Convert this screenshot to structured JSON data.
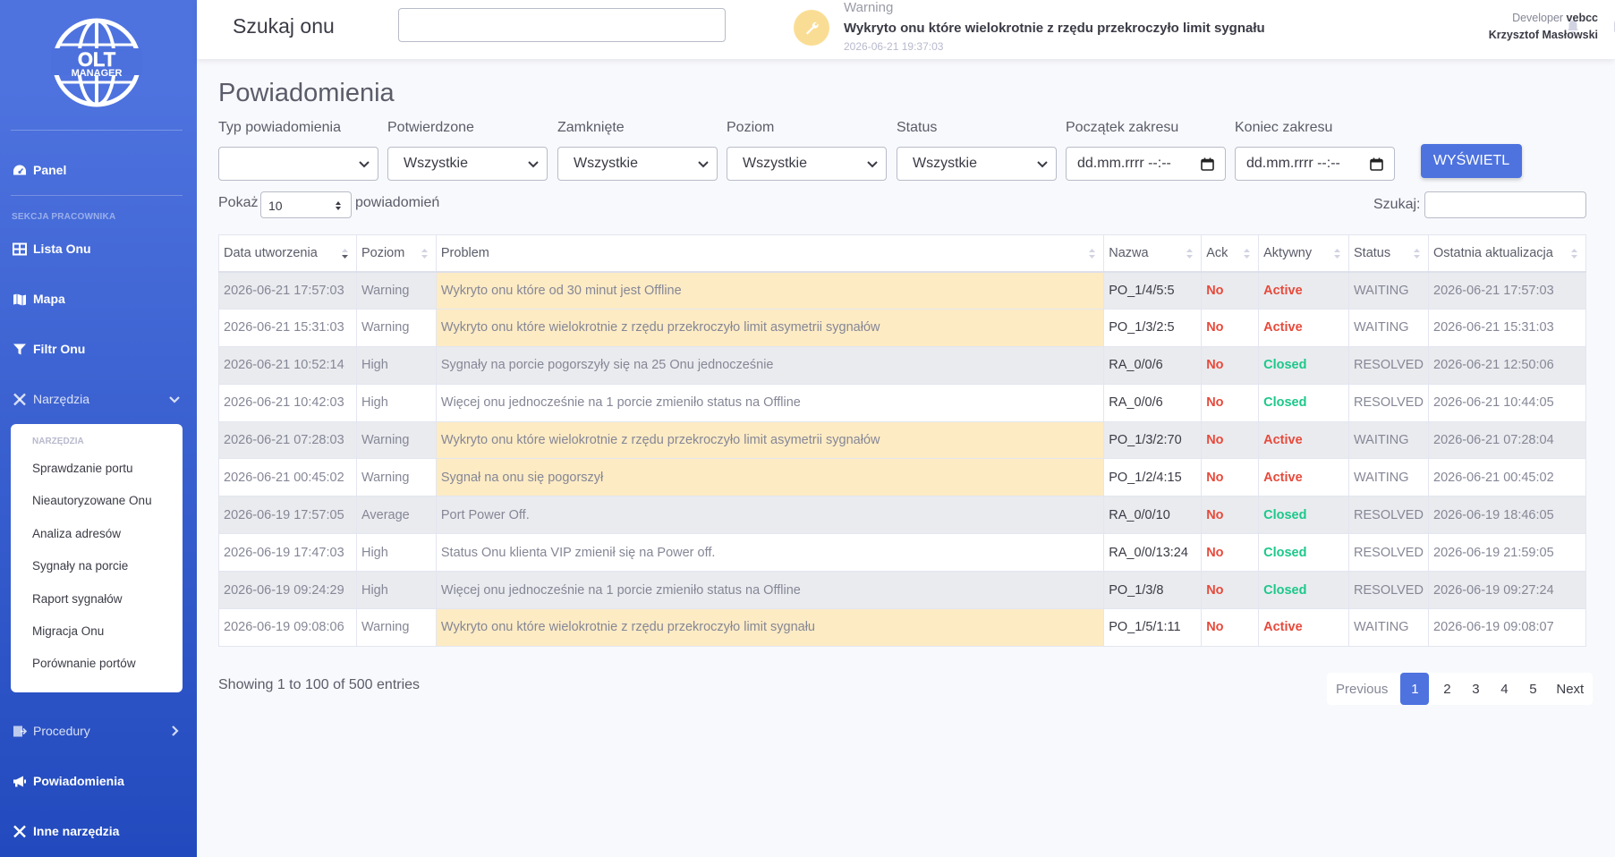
{
  "sidebar": {
    "logo_text_top": "OLT",
    "logo_text_bottom": "MANAGER",
    "panel": "Panel",
    "section_heading": "SEKCJA PRACOWNIKA",
    "items": {
      "lista_onu": "Lista Onu",
      "mapa": "Mapa",
      "filtr_onu": "Filtr Onu",
      "narzedzia": "Narzędzia",
      "procedury": "Procedury",
      "powiadomienia": "Powiadomienia",
      "inne": "Inne narzędzia"
    },
    "submenu": {
      "heading": "NARZĘDZIA",
      "items": [
        "Sprawdzanie portu",
        "Nieautoryzowane Onu",
        "Analiza adresów",
        "Sygnały na porcie",
        "Raport sygnałów",
        "Migracja Onu",
        "Porównanie portów"
      ]
    }
  },
  "topbar": {
    "search_title": "Szukaj onu",
    "alert_level": "Warning",
    "alert_message": "Wykryto onu które wielokrotnie z rzędu przekroczyło limit sygnału",
    "alert_time": "2026-06-21 19:37:03",
    "user_role": "Developer",
    "user_login": "vebcc",
    "user_name": "Krzysztof Masłowski"
  },
  "page": {
    "title": "Powiadomienia",
    "filters": {
      "type_label": "Typ powiadomienia",
      "type_value": "",
      "confirmed_label": "Potwierdzone",
      "confirmed_value": "Wszystkie",
      "closed_label": "Zamknięte",
      "closed_value": "Wszystkie",
      "level_label": "Poziom",
      "level_value": "Wszystkie",
      "status_label": "Status",
      "status_value": "Wszystkie",
      "start_label": "Początek zakresu",
      "start_placeholder": "dd.mm.rrrr --:--",
      "end_label": "Koniec zakresu",
      "end_placeholder": "dd.mm.rrrr --:--",
      "button": "WYŚWIETL"
    },
    "show_label": "Pokaż",
    "show_value": "10",
    "show_suffix": "powiadomień",
    "search_label": "Szukaj:",
    "table": {
      "headers": [
        "Data utworzenia",
        "Poziom",
        "Problem",
        "Nazwa",
        "Ack",
        "Aktywny",
        "Status",
        "Ostatnia aktualizacja"
      ],
      "rows": [
        [
          "2026-06-21 17:57:03",
          "Warning",
          "Wykryto onu które od 30 minut jest Offline",
          "PO_1/4/5:5",
          "No",
          "Active",
          "WAITING",
          "2026-06-21 17:57:03"
        ],
        [
          "2026-06-21 15:31:03",
          "Warning",
          "Wykryto onu które wielokrotnie z rzędu przekroczyło limit asymetrii sygnałów",
          "PO_1/3/2:5",
          "No",
          "Active",
          "WAITING",
          "2026-06-21 15:31:03"
        ],
        [
          "2026-06-21 10:52:14",
          "High",
          "Sygnały na porcie pogorszyły się na 25 Onu jednocześnie",
          "RA_0/0/6",
          "No",
          "Closed",
          "RESOLVED",
          "2026-06-21 12:50:06"
        ],
        [
          "2026-06-21 10:42:03",
          "High",
          "Więcej onu jednocześnie na 1 porcie zmieniło status na Offline",
          "RA_0/0/6",
          "No",
          "Closed",
          "RESOLVED",
          "2026-06-21 10:44:05"
        ],
        [
          "2026-06-21 07:28:03",
          "Warning",
          "Wykryto onu które wielokrotnie z rzędu przekroczyło limit asymetrii sygnałów",
          "PO_1/3/2:70",
          "No",
          "Active",
          "WAITING",
          "2026-06-21 07:28:04"
        ],
        [
          "2026-06-21 00:45:02",
          "Warning",
          "Sygnał na onu się pogorszył",
          "PO_1/2/4:15",
          "No",
          "Active",
          "WAITING",
          "2026-06-21 00:45:02"
        ],
        [
          "2026-06-19 17:57:05",
          "Average",
          "Port Power Off.",
          "RA_0/0/10",
          "No",
          "Closed",
          "RESOLVED",
          "2026-06-19 18:46:05"
        ],
        [
          "2026-06-19 17:47:03",
          "High",
          "Status Onu klienta VIP zmienił się na Power off.",
          "RA_0/0/13:24",
          "No",
          "Closed",
          "RESOLVED",
          "2026-06-19 21:59:05"
        ],
        [
          "2026-06-19 09:24:29",
          "High",
          "Więcej onu jednocześnie na 1 porcie zmieniło status na Offline",
          "PO_1/3/8",
          "No",
          "Closed",
          "RESOLVED",
          "2026-06-19 09:27:24"
        ],
        [
          "2026-06-19 09:08:06",
          "Warning",
          "Wykryto onu które wielokrotnie z rzędu przekroczyło limit sygnału",
          "PO_1/5/1:11",
          "No",
          "Active",
          "WAITING",
          "2026-06-19 09:08:07"
        ]
      ]
    },
    "entries_info": "Showing 1 to 100 of 500 entries",
    "pagination": {
      "previous": "Previous",
      "pages": [
        "1",
        "2",
        "3",
        "4",
        "5"
      ],
      "active_page": "1",
      "next": "Next"
    }
  },
  "colors": {
    "primary": "#4e73df",
    "warning_row": "#fdebc4",
    "danger": "#e74a3b",
    "success": "#1cc88a"
  }
}
